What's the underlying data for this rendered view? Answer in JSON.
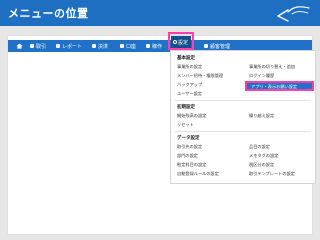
{
  "page": {
    "title": "メニューの位置"
  },
  "nav": {
    "items": [
      "取引",
      "レポート",
      "決済",
      "口座",
      "稼作",
      "設定",
      "顧客管理"
    ]
  },
  "menu": {
    "basic": {
      "header": "基本設定",
      "left": [
        "事業所の設定",
        "メンバー招待・権限管理",
        "バックアップ",
        "ユーザー設定"
      ],
      "right": [
        "事業所の切り替え・追加",
        "ログイン履歴",
        "アプリ・表示お願い設定"
      ]
    },
    "initial": {
      "header": "初期設定",
      "left": [
        "開始残高の設定",
        "リセット"
      ],
      "right": [
        "繰り越え設定"
      ]
    },
    "data": {
      "header": "データ設定",
      "left": [
        "取引先の設定",
        "部門の設定",
        "勘定科目の設定",
        "自動登録ルールの設定"
      ],
      "right": [
        "品目の設定",
        "メモタグの設定",
        "税区分の設定",
        "取引テンプレートの設定"
      ]
    }
  }
}
